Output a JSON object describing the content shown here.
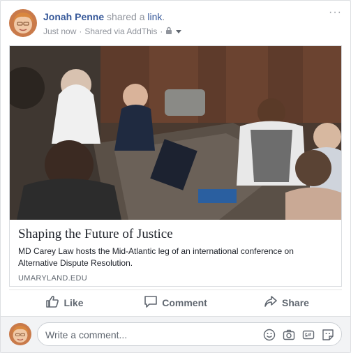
{
  "post": {
    "author": "Jonah Penne",
    "shared_text": " shared a ",
    "link_word": "link",
    "period": ".",
    "timestamp": "Just now",
    "separator": " · ",
    "via": "Shared via AddThis",
    "separator2": " · ",
    "more_label": "···",
    "avatar_icon": "user-avatar",
    "privacy_icon": "lock-icon",
    "audience_icon": "caret-down-icon"
  },
  "attachment": {
    "title": "Shaping the Future of Justice",
    "description": "MD Carey Law hosts the Mid-Atlantic leg of an international conference on Alternative Dispute Resolution.",
    "domain": "UMARYLAND.EDU",
    "image_icon": "conference-photo"
  },
  "actions": [
    {
      "label": "Like",
      "icon": "thumbs-up-icon"
    },
    {
      "label": "Comment",
      "icon": "comment-bubble-icon"
    },
    {
      "label": "Share",
      "icon": "share-arrow-icon"
    }
  ],
  "comment": {
    "placeholder": "Write a comment...",
    "icons": [
      "emoji-icon",
      "camera-icon",
      "gif-icon",
      "sticker-icon"
    ]
  },
  "colors": {
    "link_blue": "#365899",
    "meta_gray": "#90949c",
    "action_gray": "#606770",
    "border": "#dddfe2"
  }
}
